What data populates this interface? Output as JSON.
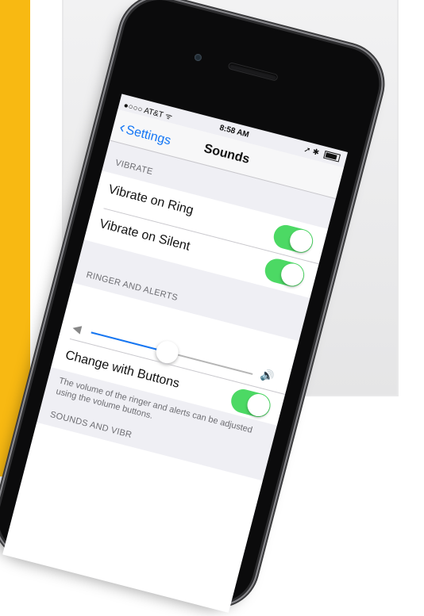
{
  "status_bar": {
    "carrier": "●○○○ AT&T ᯤ",
    "time": "8:58 AM",
    "right_icons": "➚ ✱"
  },
  "nav": {
    "back_label": "Settings",
    "title": "Sounds"
  },
  "sections": {
    "vibrate": {
      "header": "VIBRATE",
      "rows": [
        {
          "label": "Vibrate on Ring",
          "on": true
        },
        {
          "label": "Vibrate on Silent",
          "on": true
        }
      ]
    },
    "ringer": {
      "header": "RINGER AND ALERTS",
      "volume_fraction": 0.47,
      "change_with_buttons": {
        "label": "Change with Buttons",
        "on": true
      },
      "footer": "The volume of the ringer and alerts can be adjusted using the volume buttons."
    },
    "sounds": {
      "header": "SOUNDS AND VIBR"
    }
  },
  "colors": {
    "accent": "#1577f5",
    "toggle_on": "#4cd964",
    "background": "#efeff4",
    "side_band": "#f8b912"
  },
  "icons": {
    "volume_low": "speaker-low-icon",
    "volume_high": "speaker-high-icon",
    "back": "chevron-left-icon"
  }
}
